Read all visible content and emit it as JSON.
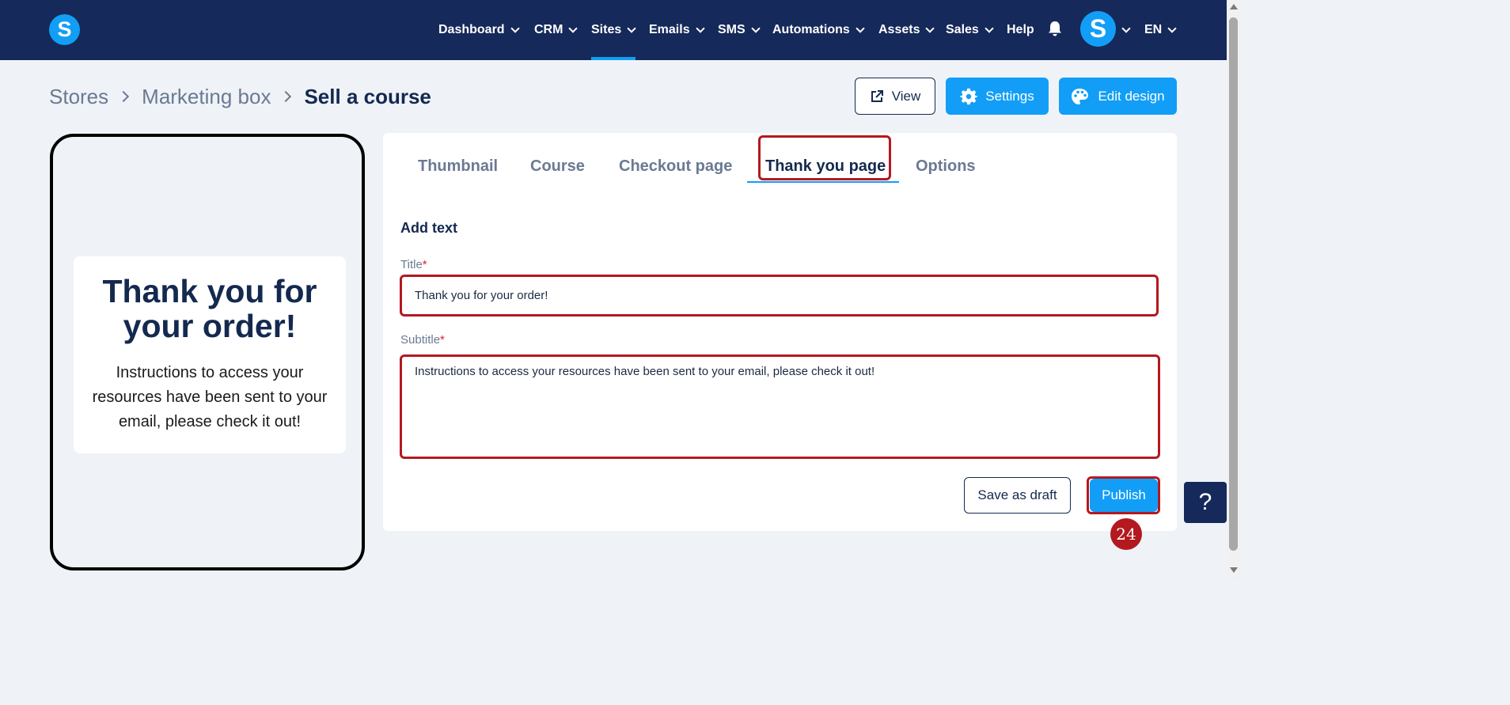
{
  "nav": {
    "logo": "S",
    "items": [
      {
        "label": "Dashboard"
      },
      {
        "label": "CRM"
      },
      {
        "label": "Sites"
      },
      {
        "label": "Emails"
      },
      {
        "label": "SMS"
      },
      {
        "label": "Automations"
      },
      {
        "label": "Assets"
      },
      {
        "label": "Sales"
      },
      {
        "label": "Help"
      }
    ],
    "active": "Sites",
    "avatar": "S",
    "language": "EN"
  },
  "breadcrumb": [
    "Stores",
    "Marketing box",
    "Sell a course"
  ],
  "header_buttons": {
    "view": "View",
    "settings": "Settings",
    "edit_design": "Edit design"
  },
  "preview": {
    "title": "Thank you for your order!",
    "subtitle": "Instructions to access your resources have been sent to your email, please check it out!"
  },
  "tabs": [
    "Thumbnail",
    "Course",
    "Checkout page",
    "Thank you page",
    "Options"
  ],
  "active_tab": "Thank you page",
  "form": {
    "section": "Add text",
    "title_label": "Title",
    "title_value": "Thank you for your order!",
    "subtitle_label": "Subtitle",
    "subtitle_value": "Instructions to access your resources have been sent to your email, please check it out!",
    "required_mark": "*"
  },
  "actions": {
    "save_draft": "Save as draft",
    "publish": "Publish"
  },
  "help_button": "?",
  "step_badge": "24",
  "colors": {
    "nav_bg": "#15295a",
    "accent": "#129ef6",
    "highlight": "#b3191f"
  }
}
